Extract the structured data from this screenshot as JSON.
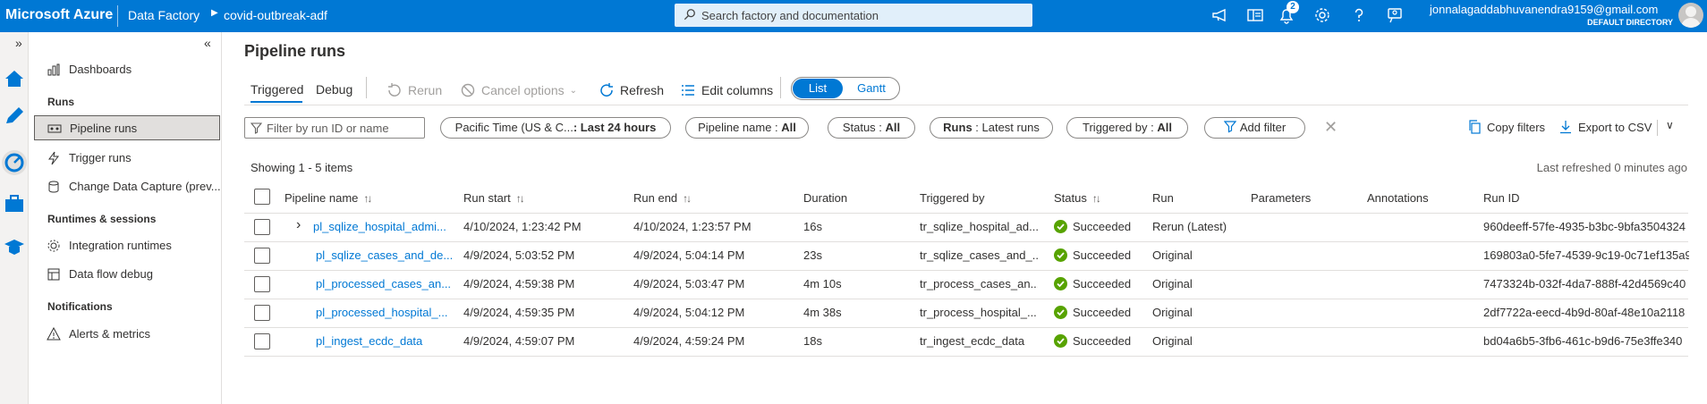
{
  "topbar": {
    "brand": "Microsoft Azure",
    "crumbs": [
      "Data Factory",
      "covid-outbreak-adf"
    ],
    "search_placeholder": "Search factory and documentation",
    "notification_count": "2",
    "user_email": "jonnalagaddabhuvanendra9159@gmail.com",
    "user_directory": "DEFAULT DIRECTORY"
  },
  "rail": {
    "expand": "»",
    "items": [
      "home-icon",
      "pencil-icon",
      "monitor-icon",
      "toolbox-icon",
      "learning-icon"
    ]
  },
  "sidebar": {
    "collapse": "«",
    "items": [
      {
        "label": "Dashboards",
        "icon": "dashboard-icon"
      },
      {
        "section": "Runs"
      },
      {
        "label": "Pipeline runs",
        "icon": "pipeline-runs-icon",
        "active": true
      },
      {
        "label": "Trigger runs",
        "icon": "trigger-icon"
      },
      {
        "label": "Change Data Capture (prev...",
        "icon": "cdc-icon"
      },
      {
        "section": "Runtimes & sessions"
      },
      {
        "label": "Integration runtimes",
        "icon": "runtime-icon"
      },
      {
        "label": "Data flow debug",
        "icon": "dataflow-icon"
      },
      {
        "section": "Notifications"
      },
      {
        "label": "Alerts & metrics",
        "icon": "alert-icon"
      }
    ]
  },
  "main": {
    "title": "Pipeline runs",
    "tabs": [
      "Triggered",
      "Debug"
    ],
    "toolbar": {
      "rerun": "Rerun",
      "cancel": "Cancel options",
      "refresh": "Refresh",
      "edit_columns": "Edit columns",
      "view_list": "List",
      "view_gantt": "Gantt"
    },
    "filters": {
      "search_placeholder": "Filter by run ID or name",
      "time_prefix": "Pacific Time (US & C...",
      "time_value": ": Last 24 hours",
      "pipeline_prefix": "Pipeline name : ",
      "pipeline_value": "All",
      "status_prefix": "Status : ",
      "status_value": "All",
      "runs_prefix": "Runs",
      "runs_value": " : Latest runs",
      "triggered_prefix": "Triggered by : ",
      "triggered_value": "All",
      "add_filter": "Add filter",
      "clear": "✕",
      "copy_filters": "Copy filters",
      "export_csv": "Export to CSV"
    },
    "showing": "Showing 1 - 5 items",
    "refreshed": "Last refreshed 0 minutes ago",
    "columns": [
      "Pipeline name",
      "Run start",
      "Run end",
      "Duration",
      "Triggered by",
      "Status",
      "Run",
      "Parameters",
      "Annotations",
      "Run ID"
    ],
    "rows": [
      {
        "name": "pl_sqlize_hospital_admi...",
        "start": "4/10/2024, 1:23:42 PM",
        "end": "4/10/2024, 1:23:57 PM",
        "duration": "16s",
        "triggered": "tr_sqlize_hospital_ad...",
        "status": "Succeeded",
        "run": "Rerun (Latest)",
        "run_id": "960deeff-57fe-4935-b3bc-9bfa3504324",
        "expandable": true
      },
      {
        "name": "pl_sqlize_cases_and_de...",
        "start": "4/9/2024, 5:03:52 PM",
        "end": "4/9/2024, 5:04:14 PM",
        "duration": "23s",
        "triggered": "tr_sqlize_cases_and_...",
        "status": "Succeeded",
        "run": "Original",
        "run_id": "169803a0-5fe7-4539-9c19-0c71ef135a9"
      },
      {
        "name": "pl_processed_cases_an...",
        "start": "4/9/2024, 4:59:38 PM",
        "end": "4/9/2024, 5:03:47 PM",
        "duration": "4m 10s",
        "triggered": "tr_process_cases_an...",
        "status": "Succeeded",
        "run": "Original",
        "run_id": "7473324b-032f-4da7-888f-42d4569c40"
      },
      {
        "name": "pl_processed_hospital_...",
        "start": "4/9/2024, 4:59:35 PM",
        "end": "4/9/2024, 5:04:12 PM",
        "duration": "4m 38s",
        "triggered": "tr_process_hospital_...",
        "status": "Succeeded",
        "run": "Original",
        "run_id": "2df7722a-eecd-4b9d-80af-48e10a2118"
      },
      {
        "name": "pl_ingest_ecdc_data",
        "start": "4/9/2024, 4:59:07 PM",
        "end": "4/9/2024, 4:59:24 PM",
        "duration": "18s",
        "triggered": "tr_ingest_ecdc_data",
        "status": "Succeeded",
        "run": "Original",
        "run_id": "bd04a6b5-3fb6-461c-b9d6-75e3ffe340"
      }
    ]
  }
}
